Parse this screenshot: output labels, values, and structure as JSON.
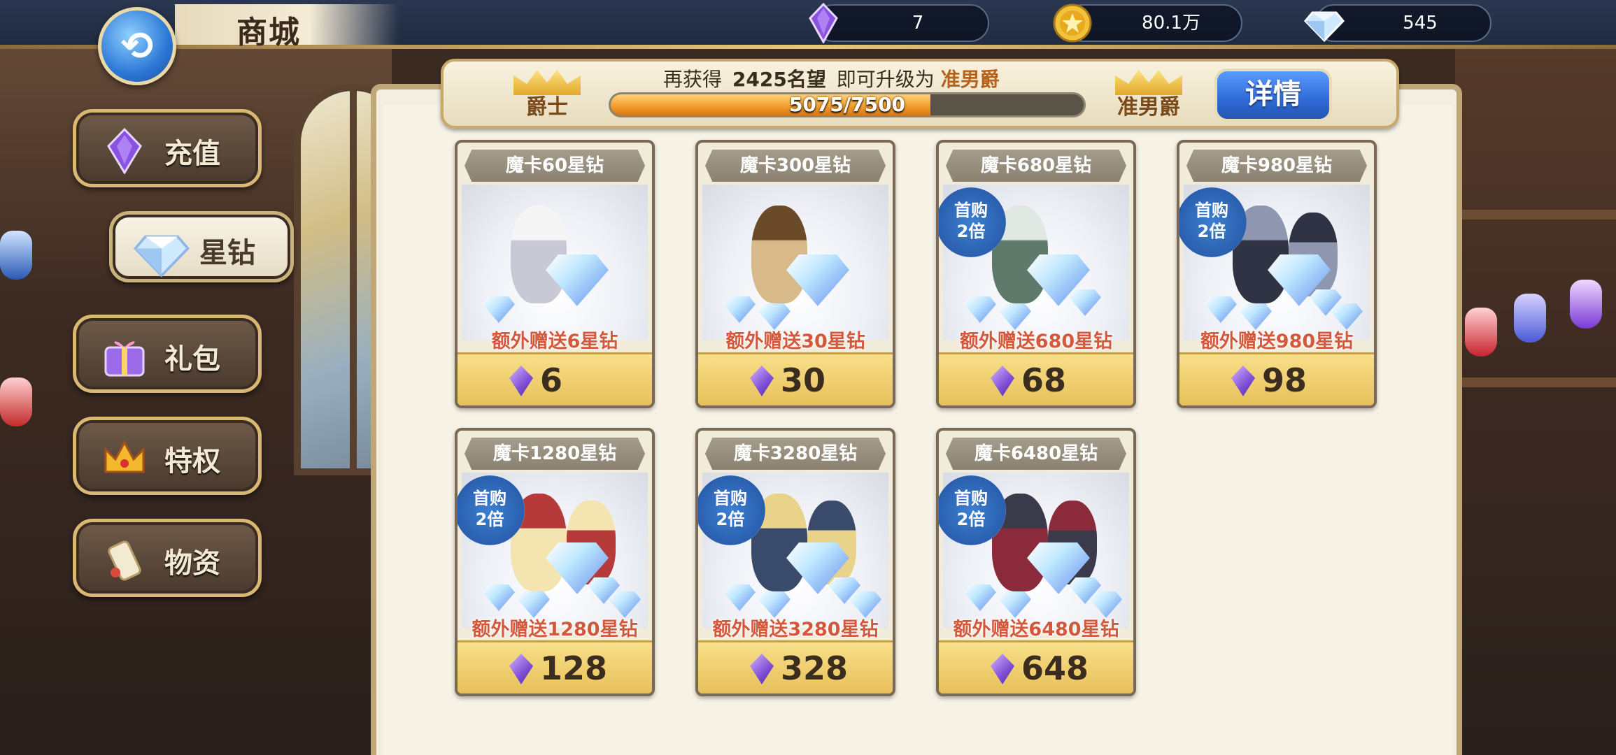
{
  "header": {
    "title": "商城",
    "back_icon": "back-swirl-icon"
  },
  "currencies": [
    {
      "name": "purple-gem",
      "value": "7"
    },
    {
      "name": "gold-coin",
      "value": "80.1万"
    },
    {
      "name": "diamond",
      "value": "545"
    }
  ],
  "sidebar": {
    "items": [
      {
        "label": "充值",
        "icon": "purple-gem-icon",
        "active": false
      },
      {
        "label": "星钻",
        "icon": "diamond-icon",
        "active": true
      },
      {
        "label": "礼包",
        "icon": "gift-box-icon",
        "active": false
      },
      {
        "label": "特权",
        "icon": "crown-icon",
        "active": false
      },
      {
        "label": "物资",
        "icon": "scroll-icon",
        "active": false
      }
    ]
  },
  "rank": {
    "message_prefix": "再获得",
    "amount_needed": "2425名望",
    "message_mid": "即可升级为",
    "next_rank": "准男爵",
    "current_rank_label": "爵士",
    "next_rank_label": "准男爵",
    "progress_text": "5075/7500",
    "progress_current": 5075,
    "progress_max": 7500,
    "detail_button": "详情"
  },
  "products": [
    {
      "title": "魔卡60星钻",
      "bonus": "额外赠送6星钻",
      "price": "6",
      "badge": false
    },
    {
      "title": "魔卡300星钻",
      "bonus": "额外赠送30星钻",
      "price": "30",
      "badge": false
    },
    {
      "title": "魔卡680星钻",
      "bonus": "额外赠送680星钻",
      "price": "68",
      "badge": true
    },
    {
      "title": "魔卡980星钻",
      "bonus": "额外赠送980星钻",
      "price": "98",
      "badge": true
    },
    {
      "title": "魔卡1280星钻",
      "bonus": "额外赠送1280星钻",
      "price": "128",
      "badge": true
    },
    {
      "title": "魔卡3280星钻",
      "bonus": "额外赠送3280星钻",
      "price": "328",
      "badge": true
    },
    {
      "title": "魔卡6480星钻",
      "bonus": "额外赠送6480星钻",
      "price": "648",
      "badge": true
    }
  ],
  "badge_text": {
    "line1": "首购",
    "line2": "2倍"
  },
  "colors": {
    "progress_fill": "#f29a2a",
    "bonus_text": "#d4583b",
    "detail_button": "#2f6bd6"
  }
}
